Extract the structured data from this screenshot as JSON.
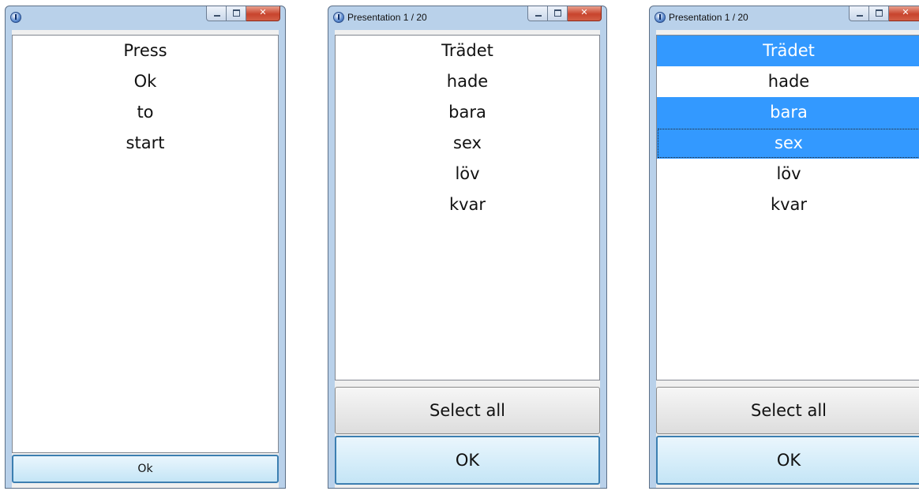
{
  "windows": [
    {
      "title": "",
      "list_items": [
        "Press",
        "Ok",
        "to",
        "start"
      ],
      "ok_label": "Ok"
    },
    {
      "title": "Presentation 1 / 20",
      "list_items": [
        "Trädet",
        "hade",
        "bara",
        "sex",
        "löv",
        "kvar"
      ],
      "select_all_label": "Select all",
      "ok_label": "OK"
    },
    {
      "title": "Presentation 1 / 20",
      "list_items": [
        "Trädet",
        "hade",
        "bara",
        "sex",
        "löv",
        "kvar"
      ],
      "selected_items": [
        "Trädet",
        "bara",
        "sex"
      ],
      "focused_item": "sex",
      "select_all_label": "Select all",
      "ok_label": "OK"
    }
  ],
  "colors": {
    "selection": "#3399ff",
    "title_bar": "#b9d1ea",
    "close_button": "#c8442d"
  },
  "icons": [
    "app-info-icon",
    "minimize-icon",
    "maximize-icon",
    "close-icon"
  ]
}
